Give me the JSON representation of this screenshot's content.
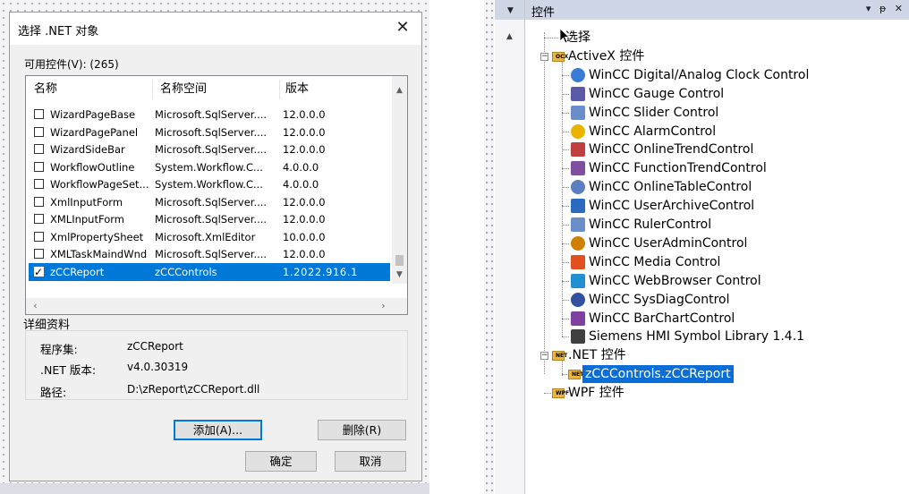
{
  "dialog": {
    "title": "选择 .NET 对象",
    "available_label": "可用控件(V): (265)",
    "columns": {
      "name": "名称",
      "namespace": "名称空间",
      "version": "版本"
    },
    "rows": [
      {
        "name": "WizardPageBase",
        "ns": "Microsoft.SqlServer....",
        "ver": "12.0.0.0",
        "checked": false
      },
      {
        "name": "WizardPagePanel",
        "ns": "Microsoft.SqlServer....",
        "ver": "12.0.0.0",
        "checked": false
      },
      {
        "name": "WizardSideBar",
        "ns": "Microsoft.SqlServer....",
        "ver": "12.0.0.0",
        "checked": false
      },
      {
        "name": "WorkflowOutline",
        "ns": "System.Workflow.C...",
        "ver": "4.0.0.0",
        "checked": false
      },
      {
        "name": "WorkflowPageSet...",
        "ns": "System.Workflow.C...",
        "ver": "4.0.0.0",
        "checked": false
      },
      {
        "name": "XmlInputForm",
        "ns": "Microsoft.SqlServer....",
        "ver": "12.0.0.0",
        "checked": false
      },
      {
        "name": "XMLInputForm",
        "ns": "Microsoft.SqlServer....",
        "ver": "12.0.0.0",
        "checked": false
      },
      {
        "name": "XmlPropertySheet",
        "ns": "Microsoft.XmlEditor",
        "ver": "10.0.0.0",
        "checked": false
      },
      {
        "name": "XMLTaskMaindWnd",
        "ns": "Microsoft.SqlServer....",
        "ver": "12.0.0.0",
        "checked": false
      },
      {
        "name": "zCCReport",
        "ns": "zCCControls",
        "ver": "1.2022.916.1",
        "checked": true,
        "selected": true
      }
    ],
    "details": {
      "title": "详细资料",
      "assembly_label": "程序集:",
      "assembly_value": "zCCReport",
      "net_version_label": ".NET 版本:",
      "net_version_value": "v4.0.30319",
      "path_label": "路径:",
      "path_value": "D:\\zReport\\zCCReport.dll"
    },
    "buttons": {
      "add": "添加(A)...",
      "delete": "删除(R)",
      "ok": "确定",
      "cancel": "取消"
    },
    "check_glyph": "✓"
  },
  "panel": {
    "title": "控件",
    "controls": "▾ ᵽ ✕",
    "tree": {
      "select": "选择",
      "activex_group": "ActiveX 控件",
      "activex_items": [
        {
          "label": "WinCC Digital/Analog Clock Control",
          "icon": "clock-icon",
          "color": "#3a7bd5"
        },
        {
          "label": "WinCC Gauge Control",
          "icon": "gauge-icon",
          "color": "#5a5aa8"
        },
        {
          "label": "WinCC Slider Control",
          "icon": "slider-icon",
          "color": "#6a8fc8"
        },
        {
          "label": "WinCC AlarmControl",
          "icon": "alarm-icon",
          "color": "#e8b400"
        },
        {
          "label": "WinCC OnlineTrendControl",
          "icon": "trend-icon",
          "color": "#c04040"
        },
        {
          "label": "WinCC FunctionTrendControl",
          "icon": "function-trend-icon",
          "color": "#8050a0"
        },
        {
          "label": "WinCC OnlineTableControl",
          "icon": "table-icon",
          "color": "#5a7fc0"
        },
        {
          "label": "WinCC UserArchiveControl",
          "icon": "archive-icon",
          "color": "#2a6ac0"
        },
        {
          "label": "WinCC RulerControl",
          "icon": "ruler-icon",
          "color": "#6a8fc8"
        },
        {
          "label": "WinCC UserAdminControl",
          "icon": "users-icon",
          "color": "#d08000"
        },
        {
          "label": "WinCC Media Control",
          "icon": "media-icon",
          "color": "#e05020"
        },
        {
          "label": "WinCC WebBrowser Control",
          "icon": "globe-icon",
          "color": "#2090d0"
        },
        {
          "label": "WinCC SysDiagControl",
          "icon": "sysdiag-icon",
          "color": "#3050a0"
        },
        {
          "label": "WinCC BarChartControl",
          "icon": "barchart-icon",
          "color": "#8040a0"
        },
        {
          "label": "Siemens HMI Symbol Library 1.4.1",
          "icon": "symbol-library-icon",
          "color": "#404040"
        }
      ],
      "net_group": ".NET 控件",
      "net_items": [
        {
          "label": "zCCControls.zCCReport",
          "icon": "net-control-icon"
        }
      ],
      "wpf_group": "WPF 控件",
      "badges": {
        "activex": "OCX",
        "net": "NET",
        "wpf": "WPF"
      }
    }
  }
}
